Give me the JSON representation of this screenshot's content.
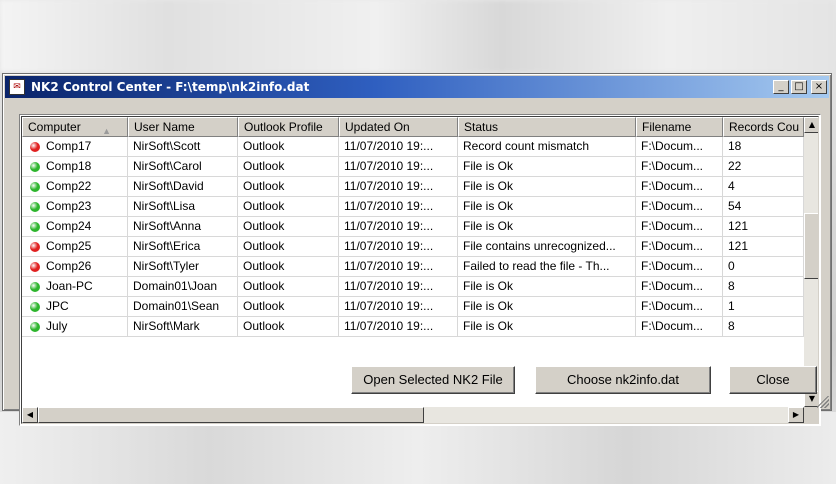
{
  "window": {
    "title": "NK2 Control Center  -  F:\\temp\\nk2info.dat",
    "icon": "app-icon",
    "controls": {
      "minimize": "_",
      "maximize": "□",
      "close": "×"
    }
  },
  "table": {
    "sort_column": "Computer",
    "sort_direction": "ascending",
    "columns": [
      "Computer",
      "User Name",
      "Outlook Profile",
      "Updated On",
      "Status",
      "Filename",
      "Records Cou"
    ],
    "rows": [
      {
        "status_color": "#e02020",
        "cells": [
          "Comp17",
          "NirSoft\\Scott",
          "Outlook",
          "11/07/2010 19:...",
          "Record count mismatch",
          "F:\\Docum...",
          "18"
        ]
      },
      {
        "status_color": "#2db52d",
        "cells": [
          "Comp18",
          "NirSoft\\Carol",
          "Outlook",
          "11/07/2010 19:...",
          "File is Ok",
          "F:\\Docum...",
          "22"
        ]
      },
      {
        "status_color": "#2db52d",
        "cells": [
          "Comp22",
          "NirSoft\\David",
          "Outlook",
          "11/07/2010 19:...",
          "File is Ok",
          "F:\\Docum...",
          "4"
        ]
      },
      {
        "status_color": "#2db52d",
        "cells": [
          "Comp23",
          "NirSoft\\Lisa",
          "Outlook",
          "11/07/2010 19:...",
          "File is Ok",
          "F:\\Docum...",
          "54"
        ]
      },
      {
        "status_color": "#2db52d",
        "cells": [
          "Comp24",
          "NirSoft\\Anna",
          "Outlook",
          "11/07/2010 19:...",
          "File is Ok",
          "F:\\Docum...",
          "121"
        ]
      },
      {
        "status_color": "#e02020",
        "cells": [
          "Comp25",
          "NirSoft\\Erica",
          "Outlook",
          "11/07/2010 19:...",
          "File contains unrecognized...",
          "F:\\Docum...",
          "121"
        ]
      },
      {
        "status_color": "#e02020",
        "cells": [
          "Comp26",
          "NirSoft\\Tyler",
          "Outlook",
          "11/07/2010 19:...",
          "Failed to read the file  - Th...",
          "F:\\Docum...",
          "0"
        ]
      },
      {
        "status_color": "#2db52d",
        "cells": [
          "Joan-PC",
          "Domain01\\Joan",
          "Outlook",
          "11/07/2010 19:...",
          "File is Ok",
          "F:\\Docum...",
          "8"
        ]
      },
      {
        "status_color": "#2db52d",
        "cells": [
          "JPC",
          "Domain01\\Sean",
          "Outlook",
          "11/07/2010 19:...",
          "File is Ok",
          "F:\\Docum...",
          "1"
        ]
      },
      {
        "status_color": "#2db52d",
        "cells": [
          "July",
          "NirSoft\\Mark",
          "Outlook",
          "11/07/2010 19:...",
          "File is Ok",
          "F:\\Docum...",
          "8"
        ]
      }
    ]
  },
  "buttons": {
    "open": "Open Selected NK2 File",
    "choose": "Choose nk2info.dat",
    "close": "Close"
  },
  "colors": {
    "title_gradient_start": "#0a246a",
    "title_gradient_end": "#a6caf0",
    "ok": "#2db52d",
    "error": "#e02020"
  }
}
